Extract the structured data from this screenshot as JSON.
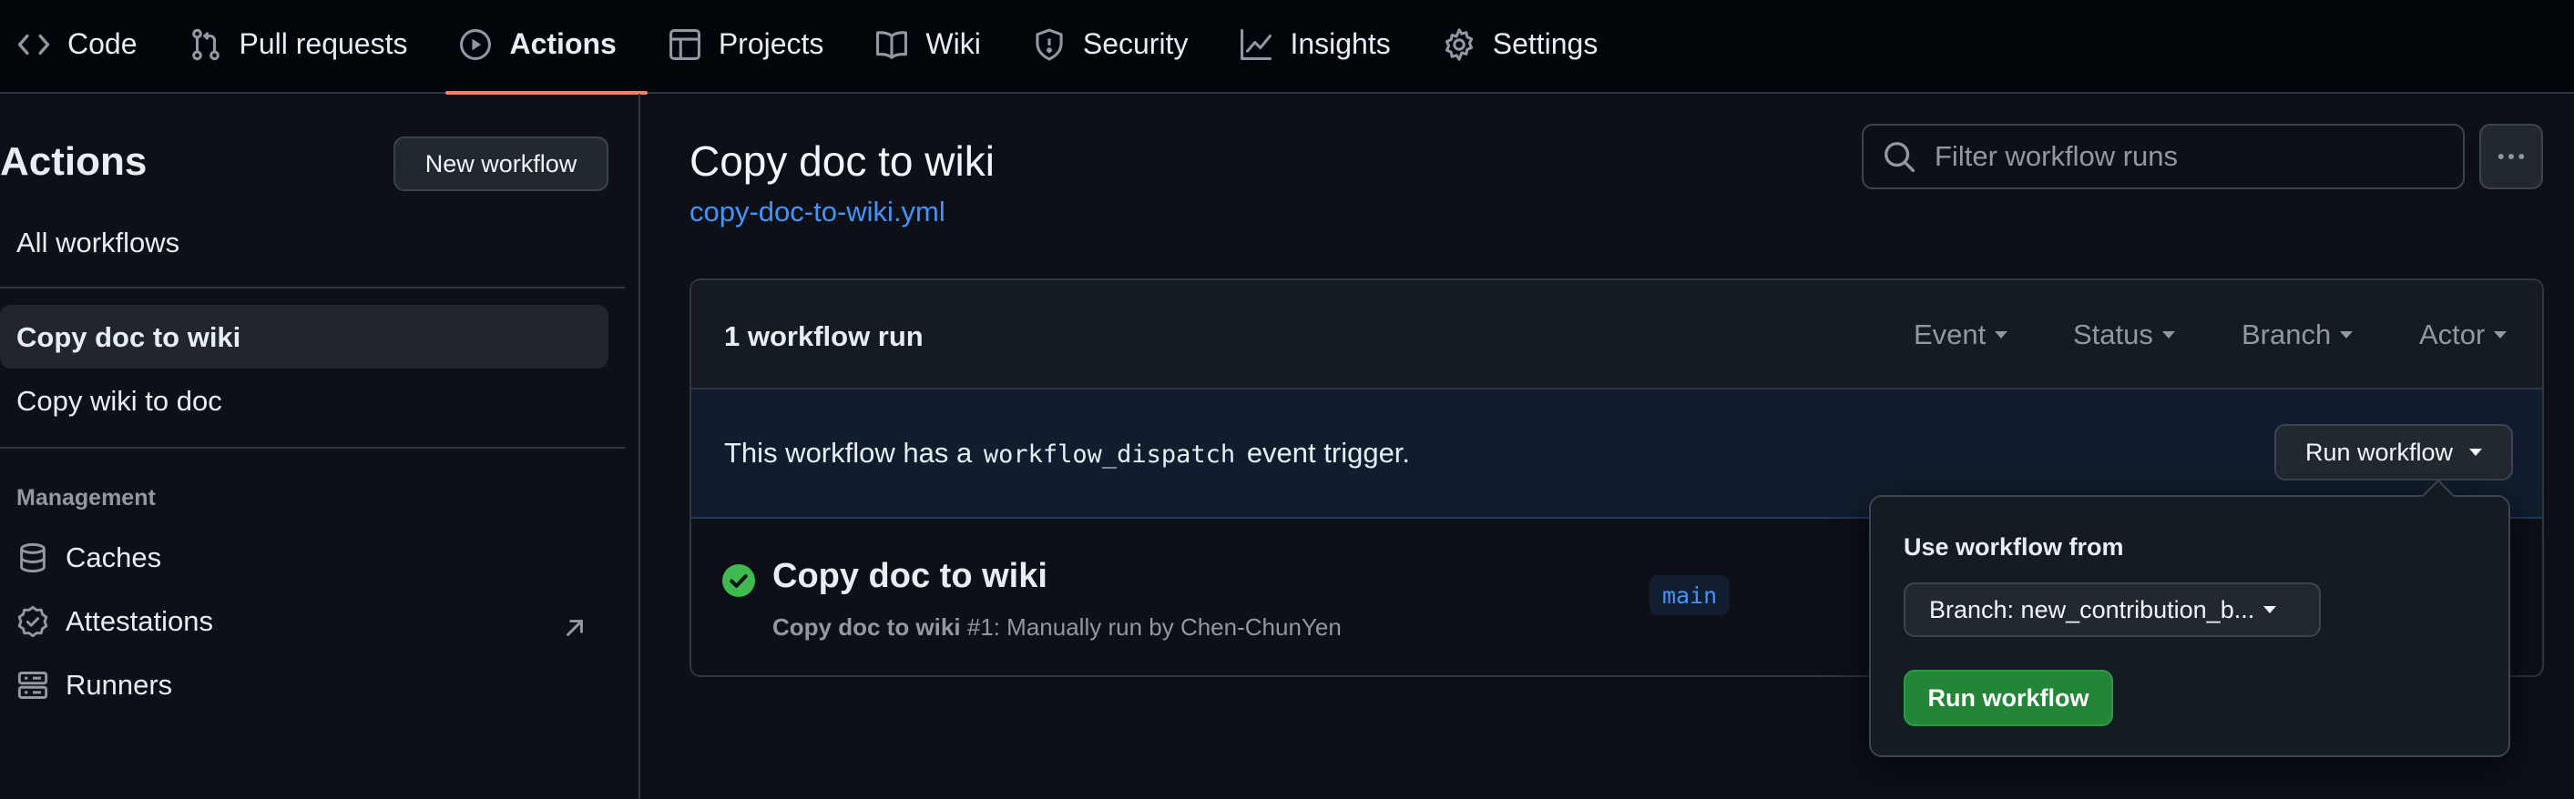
{
  "nav": {
    "items": [
      {
        "label": "Code",
        "icon": "code-icon"
      },
      {
        "label": "Pull requests",
        "icon": "pull-request-icon"
      },
      {
        "label": "Actions",
        "icon": "play-icon",
        "active": true
      },
      {
        "label": "Projects",
        "icon": "table-icon"
      },
      {
        "label": "Wiki",
        "icon": "book-icon"
      },
      {
        "label": "Security",
        "icon": "shield-icon"
      },
      {
        "label": "Insights",
        "icon": "graph-icon"
      },
      {
        "label": "Settings",
        "icon": "gear-icon"
      }
    ]
  },
  "sidebar": {
    "title": "Actions",
    "new_workflow_label": "New workflow",
    "all_workflows_label": "All workflows",
    "workflows": [
      {
        "label": "Copy doc to wiki",
        "active": true
      },
      {
        "label": "Copy wiki to doc",
        "active": false
      }
    ],
    "management_heading": "Management",
    "management_items": [
      {
        "label": "Caches",
        "icon": "database-icon"
      },
      {
        "label": "Attestations",
        "icon": "verified-icon"
      },
      {
        "label": "Runners",
        "icon": "server-icon"
      }
    ]
  },
  "main": {
    "workflow_title": "Copy doc to wiki",
    "workflow_file": "copy-doc-to-wiki.yml",
    "filter_placeholder": "Filter workflow runs",
    "runs_count": "1 workflow run",
    "filters": [
      "Event",
      "Status",
      "Branch",
      "Actor"
    ],
    "dispatch": {
      "prefix": "This workflow has a",
      "code": "workflow_dispatch",
      "suffix": "event trigger.",
      "button_label": "Run workflow"
    },
    "run": {
      "title": "Copy doc to wiki",
      "sub_bold": "Copy doc to wiki",
      "sub_rest": "#1: Manually run by Chen-ChunYen",
      "branch": "main",
      "status": "success"
    }
  },
  "popover": {
    "title": "Use workflow from",
    "branch_label": "Branch: new_contribution_b...",
    "run_label": "Run workflow"
  },
  "colors": {
    "accent_underline": "#f78166",
    "link": "#4493f8",
    "success": "#3fb950",
    "primary_button": "#238636"
  }
}
